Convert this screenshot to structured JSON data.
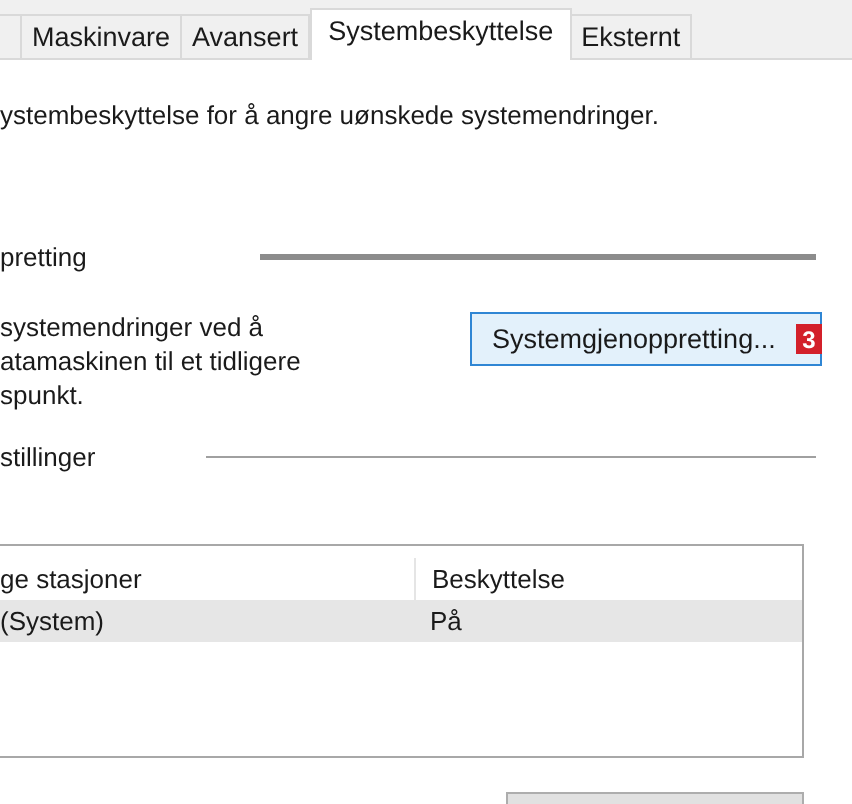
{
  "tabs": [
    {
      "label": "Maskinvare",
      "selected": false
    },
    {
      "label": "Avansert",
      "selected": false
    },
    {
      "label": "Systembeskyttelse",
      "selected": true
    },
    {
      "label": "Eksternt",
      "selected": false
    }
  ],
  "intro": "ystembeskyttelse for å angre uønskede systemendringer.",
  "restore_group": {
    "title": "pretting",
    "description": [
      "systemendringer ved å",
      "atamaskinen til et tidligere",
      "spunkt."
    ],
    "button": "Systemgjenoppretting...",
    "badge": "3"
  },
  "settings_group": {
    "title": "stillinger",
    "table": {
      "columns": [
        "ge stasjoner",
        "Beskyttelse"
      ],
      "rows": [
        {
          "cells": [
            "(System)",
            "På"
          ],
          "selected": true
        }
      ]
    }
  }
}
